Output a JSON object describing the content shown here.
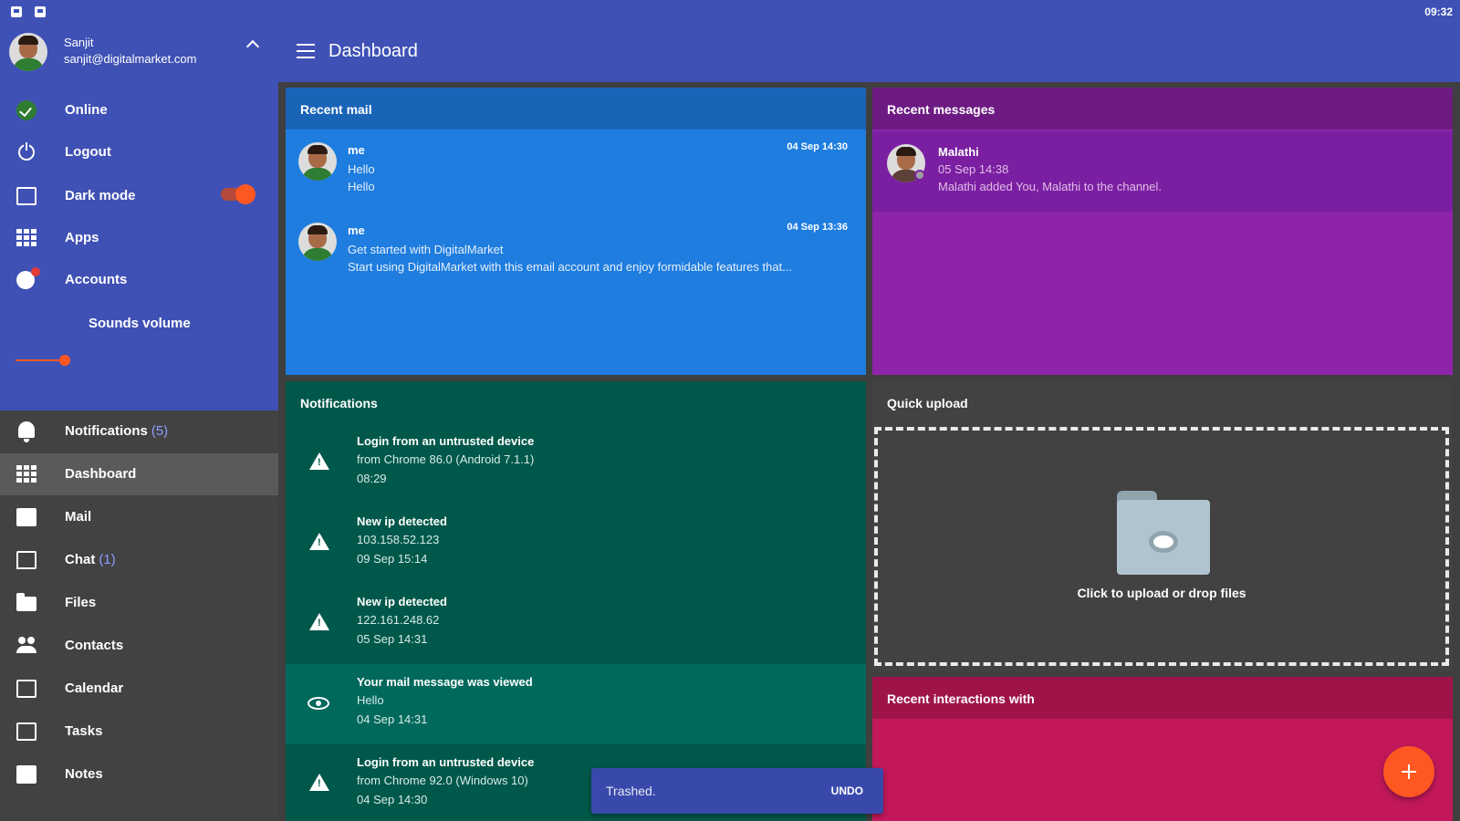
{
  "status_bar": {
    "time": "09:32"
  },
  "app_bar": {
    "title": "Dashboard"
  },
  "account": {
    "name": "Sanjit",
    "email": "sanjit@digitalmarket.com"
  },
  "drawer_top": {
    "items": [
      {
        "label": "Online",
        "icon": "check-circle-icon"
      },
      {
        "label": "Logout",
        "icon": "power-icon"
      },
      {
        "label": "Dark mode",
        "icon": "display-icon",
        "toggle_on": true
      },
      {
        "label": "Apps",
        "icon": "apps-grid-icon"
      },
      {
        "label": "Accounts",
        "icon": "accounts-icon"
      }
    ],
    "sounds_volume_label": "Sounds volume",
    "sounds_volume_value": 0.2
  },
  "nav": {
    "items": [
      {
        "label": "Notifications",
        "count": "(5)",
        "icon": "bell-icon"
      },
      {
        "label": "Dashboard",
        "icon": "dashboard-icon",
        "active": true
      },
      {
        "label": "Mail",
        "icon": "mail-icon"
      },
      {
        "label": "Chat",
        "count": "(1)",
        "icon": "chat-icon"
      },
      {
        "label": "Files",
        "icon": "folder-icon"
      },
      {
        "label": "Contacts",
        "icon": "contacts-icon"
      },
      {
        "label": "Calendar",
        "icon": "calendar-icon"
      },
      {
        "label": "Tasks",
        "icon": "tasks-icon"
      },
      {
        "label": "Notes",
        "icon": "notes-icon"
      }
    ]
  },
  "recent_mail": {
    "title": "Recent mail",
    "items": [
      {
        "from": "me",
        "date": "04 Sep 14:30",
        "line1": "Hello",
        "line2": "Hello"
      },
      {
        "from": "me",
        "date": "04 Sep 13:36",
        "line1": "Get started with DigitalMarket",
        "line2": "Start using DigitalMarket with this email account and enjoy formidable features that..."
      }
    ]
  },
  "recent_messages": {
    "title": "Recent messages",
    "items": [
      {
        "name": "Malathi",
        "date": "05 Sep 14:38",
        "text": "Malathi added You, Malathi to the channel."
      }
    ]
  },
  "notifications": {
    "title": "Notifications",
    "items": [
      {
        "title": "Login from an untrusted device",
        "sub": "from Chrome 86.0 (Android 7.1.1)",
        "time": "08:29",
        "icon": "warning-icon"
      },
      {
        "title": "New ip detected",
        "sub": "103.158.52.123",
        "time": "09 Sep 15:14",
        "icon": "warning-icon"
      },
      {
        "title": "New ip detected",
        "sub": "122.161.248.62",
        "time": "05 Sep 14:31",
        "icon": "warning-icon"
      },
      {
        "title": "Your mail message was viewed",
        "sub": "Hello",
        "time": "04 Sep 14:31",
        "icon": "eye-icon"
      },
      {
        "title": "Login from an untrusted device",
        "sub": "from Chrome 92.0 (Windows 10)",
        "time": "04 Sep 14:30",
        "icon": "warning-icon"
      }
    ]
  },
  "quick_upload": {
    "title": "Quick upload",
    "drop_text": "Click to upload or drop files"
  },
  "recent_interactions": {
    "title": "Recent interactions with"
  },
  "snackbar": {
    "text": "Trashed.",
    "action": "UNDO"
  },
  "colors": {
    "primary": "#3f51b5",
    "accent": "#ff5722",
    "mail": "#1e7ddf",
    "messages": "#8e24aa",
    "notifications": "#00584a",
    "interactions": "#c2185b"
  }
}
